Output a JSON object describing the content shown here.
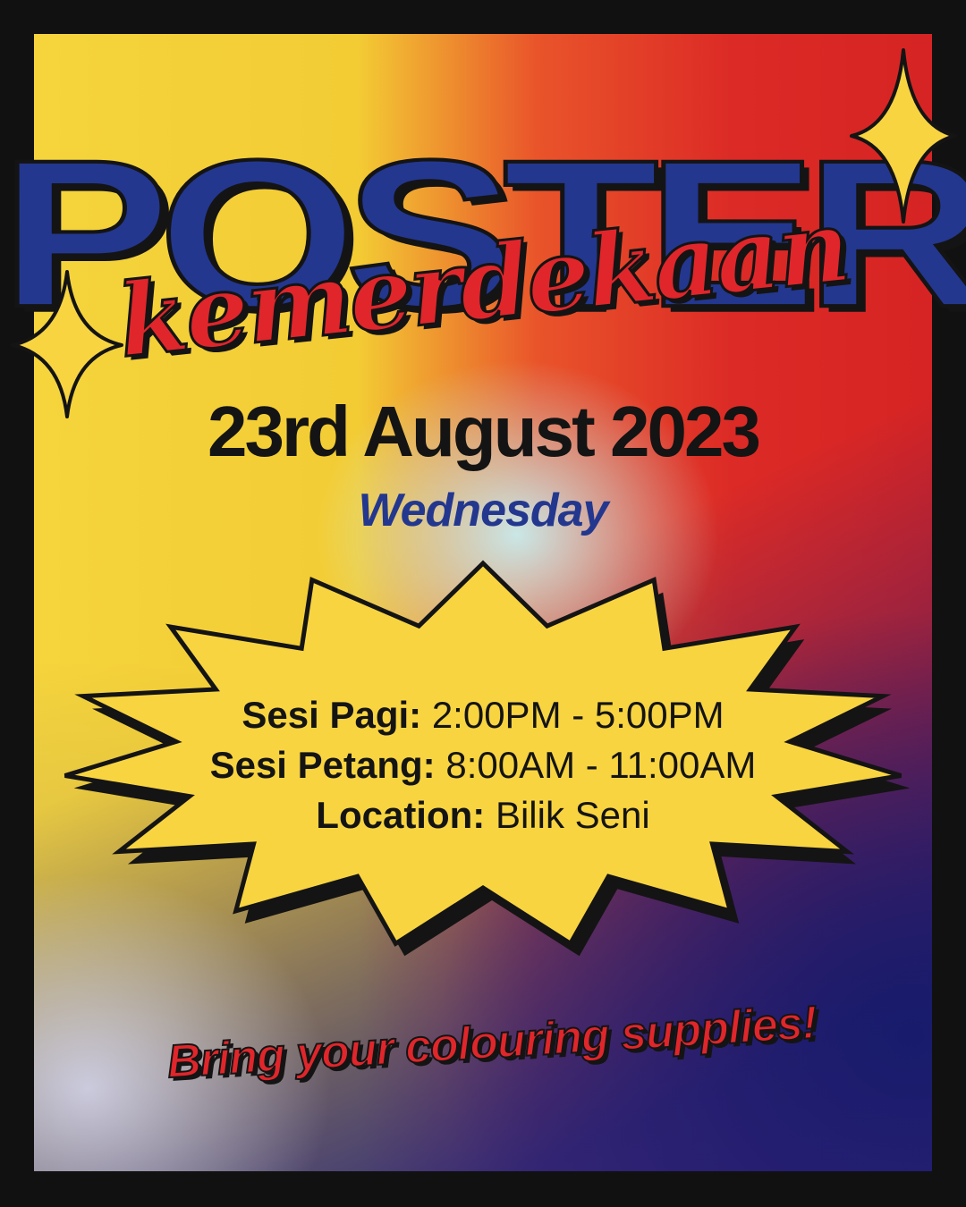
{
  "heading": {
    "title": "POSTER",
    "script_subtitle": "kemerdekaan"
  },
  "event": {
    "date": "23rd August 2023",
    "day": "Wednesday"
  },
  "schedule": {
    "morning_label": "Sesi Pagi:",
    "morning_time": "2:00PM - 5:00PM",
    "afternoon_label": "Sesi Petang:",
    "afternoon_time": "8:00AM - 11:00AM",
    "location_label": "Location:",
    "location_value": "Bilik Seni"
  },
  "tagline": "Bring your colouring supplies!",
  "colors": {
    "frame": "#111111",
    "blue": "#23378f",
    "red": "#e0262b",
    "yellow": "#f8d441",
    "ink": "#141414"
  },
  "icons": [
    "sparkle-star-icon",
    "starburst-shape"
  ]
}
